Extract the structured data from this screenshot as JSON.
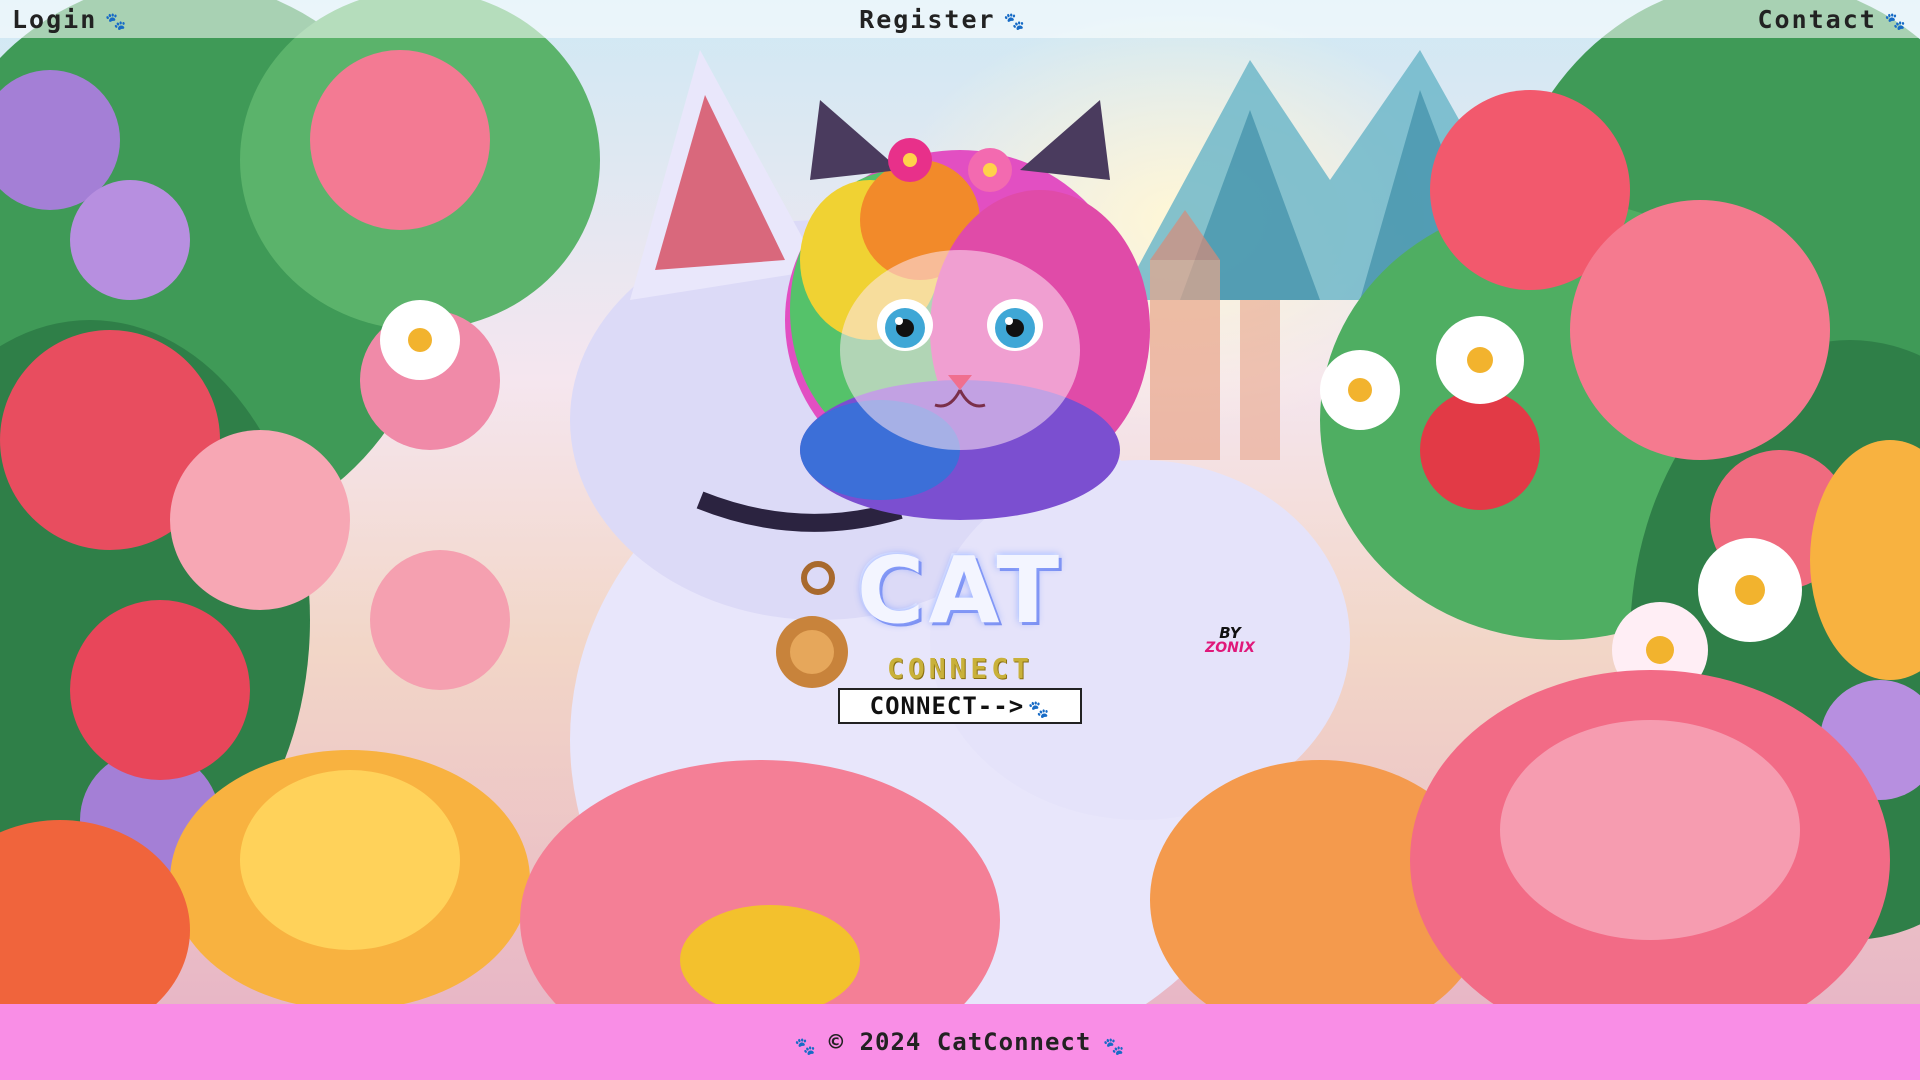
{
  "nav": {
    "login_label": "Login",
    "register_label": "Register",
    "contact_label": "Contact",
    "paw_glyph": "🐾"
  },
  "hero": {
    "title": "CAT",
    "subtitle": "CONNECT",
    "credit_by": "BY",
    "credit_name": "ZONIX"
  },
  "cta": {
    "connect_label": "CONNECT-->",
    "paw_glyph": "🐾"
  },
  "footer": {
    "copyright": "© 2024 CatConnect",
    "paw_glyph": "🐾"
  },
  "colors": {
    "footer_bg": "#f98ee6",
    "nav_bg": "rgba(255,255,255,0.55)",
    "paw": "#3b7fc4",
    "subtitle": "#c9b13a",
    "credit_name": "#e0187a"
  },
  "icons": {
    "paw": "paw-icon",
    "background": "cat-in-flower-garden-illustration",
    "logo": "rainbow-kitten-logo"
  }
}
